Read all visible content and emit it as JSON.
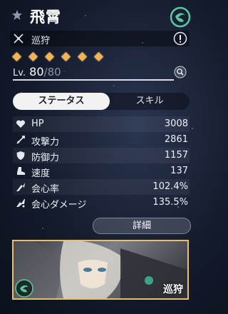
{
  "character": {
    "name": "飛霄",
    "path": "巡狩",
    "rank_count": 6,
    "level": "80",
    "max_level": "80"
  },
  "tabs": [
    {
      "label": "ステータス",
      "active": true
    },
    {
      "label": "スキル",
      "active": false
    }
  ],
  "stats": [
    {
      "icon": "heart-icon",
      "label": "HP",
      "value": "3008"
    },
    {
      "icon": "sword-icon",
      "label": "攻撃力",
      "value": "2861"
    },
    {
      "icon": "shield-icon",
      "label": "防御力",
      "value": "1157"
    },
    {
      "icon": "boot-icon",
      "label": "速度",
      "value": "137"
    },
    {
      "icon": "crit-rate-icon",
      "label": "会心率",
      "value": "102.4%"
    },
    {
      "icon": "crit-dmg-icon",
      "label": "会心ダメージ",
      "value": "135.5%"
    }
  ],
  "detail_button": {
    "label": "詳細"
  },
  "card": {
    "path_label": "巡狩"
  },
  "colors": {
    "accent_gold": "#e9c06a",
    "rank_diamond": "#f2b450",
    "wind_element": "#59c9a2"
  }
}
